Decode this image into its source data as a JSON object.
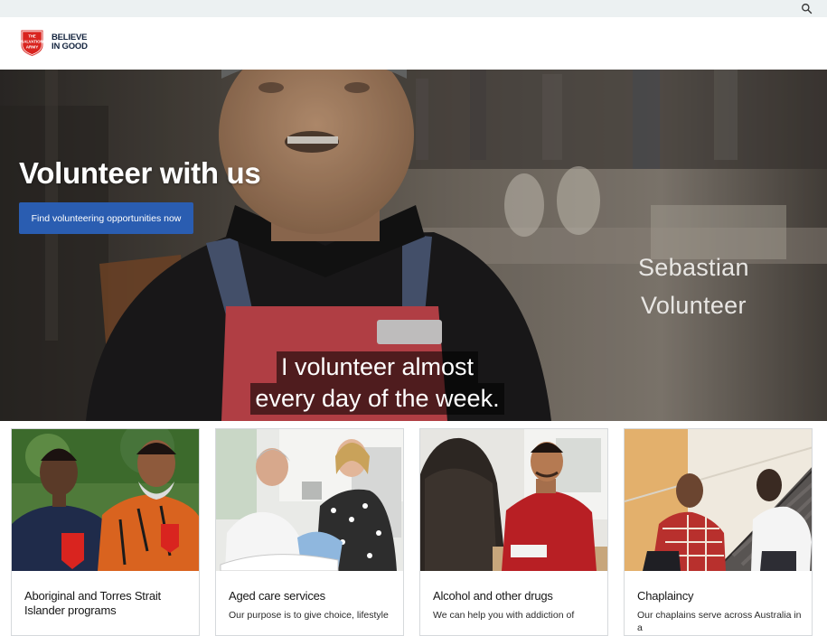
{
  "header": {
    "logo_text": [
      "THE",
      "SALVATION",
      "ARMY"
    ],
    "tagline_line1": "BELIEVE",
    "tagline_line2": "IN GOOD",
    "search_icon": "search-icon"
  },
  "hero": {
    "title": "Volunteer with us",
    "cta_label": "Find volunteering opportunities now",
    "speaker_name": "Sebastian",
    "speaker_role": "Volunteer",
    "subtitle_line1": "I volunteer almost",
    "subtitle_line2": "every day of the week.",
    "apron_color": "#c9474e"
  },
  "cards": [
    {
      "title": "Aboriginal and Torres Strait Islander programs",
      "text": ""
    },
    {
      "title": "Aged care services",
      "text": "Our purpose is to give choice, lifestyle"
    },
    {
      "title": "Alcohol and other drugs",
      "text": "We can help you with addiction of"
    },
    {
      "title": "Chaplaincy",
      "text": "Our chaplains serve across Australia in a"
    }
  ],
  "colors": {
    "brand_red": "#d9241f",
    "cta_blue": "#2a5db1",
    "navy": "#13233d"
  }
}
